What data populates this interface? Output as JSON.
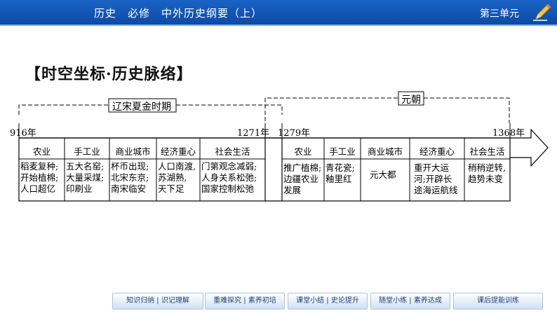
{
  "header": {
    "title": "历史　必修　中外历史纲要（上）",
    "unit": "第三单元"
  },
  "heading": "【时空坐标·历史脉络】",
  "timeline": {
    "period_left": "辽宋夏金时期",
    "period_right": "元朝",
    "years": [
      "916年",
      "1271年",
      "1279年",
      "1368年"
    ],
    "left_headers": [
      "农业",
      "手工业",
      "商业城市",
      "经济重心",
      "社会生活"
    ],
    "left_cells": [
      [
        "稻麦复种;",
        "开始植棉;",
        "人口超亿"
      ],
      [
        "五大名窑;",
        "大量采煤;",
        "印刷业"
      ],
      [
        "杯币出现;",
        "北宋东京;",
        "南宋临安"
      ],
      [
        "人口南渡,",
        "苏湖熟,",
        "天下足"
      ],
      [
        "门第观念减弱;",
        "人身关系松弛;",
        "国家控制松弛"
      ]
    ],
    "right_headers": [
      "农业",
      "手工业",
      "商业城市",
      "经济重心",
      "社会生活"
    ],
    "right_cells": [
      [
        "推广植棉;",
        "边疆农业",
        "发展"
      ],
      [
        "青花瓷;",
        "釉里红"
      ],
      [
        "元大都"
      ],
      [
        "重开大运",
        "河;开辟长",
        "途海运航线"
      ],
      [
        "稍稍逆转,",
        "趋势未变"
      ]
    ]
  },
  "nav": {
    "buttons": [
      "知识归纳 | 识记理解",
      "重难探究 | 素养初培",
      "课堂小结 | 史论提升",
      "随堂小练 | 素养达成",
      "课后提能训练"
    ]
  }
}
